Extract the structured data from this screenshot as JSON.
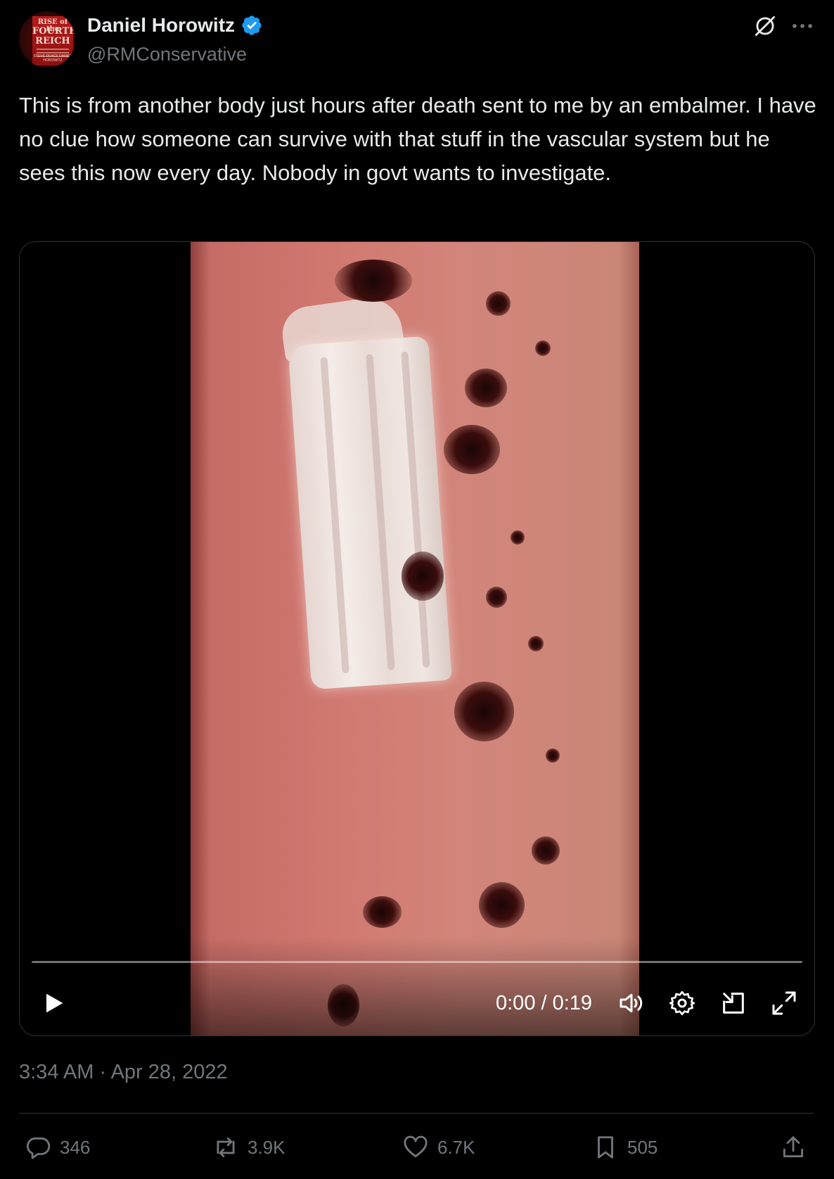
{
  "author": {
    "name": "Daniel Horowitz",
    "handle": "@RMConservative",
    "verified": true,
    "avatar_book_lines": [
      "RISE of the",
      "FOURTH",
      "REICH"
    ],
    "avatar_book_authors": "STEVE DEACE DANIEL HOROWITZ"
  },
  "top_icons": [
    "grok-icon",
    "more-icon"
  ],
  "tweet": {
    "text": "This is from another body just hours after death sent to me by an embalmer. I have no clue how someone can survive with that stuff in the vascular system but he sees this now every day. Nobody in govt wants to investigate."
  },
  "video": {
    "time": "0:00 / 0:19",
    "progress": 0,
    "icons": [
      "play-icon",
      "volume-icon",
      "settings-icon",
      "pip-icon",
      "fullscreen-icon"
    ]
  },
  "timestamp": "3:34 AM · Apr 28, 2022",
  "actions": {
    "replies": "346",
    "reposts": "3.9K",
    "likes": "6.7K",
    "bookmarks": "505"
  },
  "colors": {
    "background": "#000000",
    "text": "#e7e9ea",
    "secondary": "#71767b",
    "verified": "#1d9bf0",
    "border": "#2f3336"
  }
}
